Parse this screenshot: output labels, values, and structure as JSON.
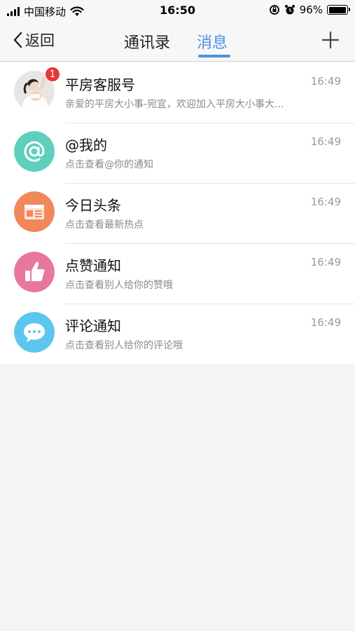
{
  "status_bar": {
    "carrier": "中国移动",
    "time": "16:50",
    "battery": "96%",
    "battery_level": 0.96
  },
  "nav": {
    "back_label": "返回",
    "tabs": [
      {
        "label": "通讯录",
        "active": false
      },
      {
        "label": "消息",
        "active": true
      }
    ],
    "plus_icon": "plus-icon"
  },
  "colors": {
    "accent": "#4a90e2",
    "badge": "#e53935",
    "at_avatar": "#5fcfbd",
    "news_avatar": "#f0885a",
    "like_avatar": "#e8779e",
    "comment_avatar": "#5cc6ee"
  },
  "messages": [
    {
      "title": "平房客服号",
      "subtitle": "亲爱的平房大小事-宛宜，欢迎加入平房大小事大...",
      "time": "16:49",
      "badge": "1",
      "icon": "user-photo"
    },
    {
      "title": "@我的",
      "subtitle": "点击查看@你的通知",
      "time": "16:49",
      "icon": "at-icon"
    },
    {
      "title": "今日头条",
      "subtitle": "点击查看最新热点",
      "time": "16:49",
      "icon": "newspaper-icon"
    },
    {
      "title": "点赞通知",
      "subtitle": "点击查看别人给你的赞哦",
      "time": "16:49",
      "icon": "thumbs-up-icon"
    },
    {
      "title": "评论通知",
      "subtitle": "点击查看别人给你的评论哦",
      "time": "16:49",
      "icon": "comment-bubble-icon"
    }
  ]
}
